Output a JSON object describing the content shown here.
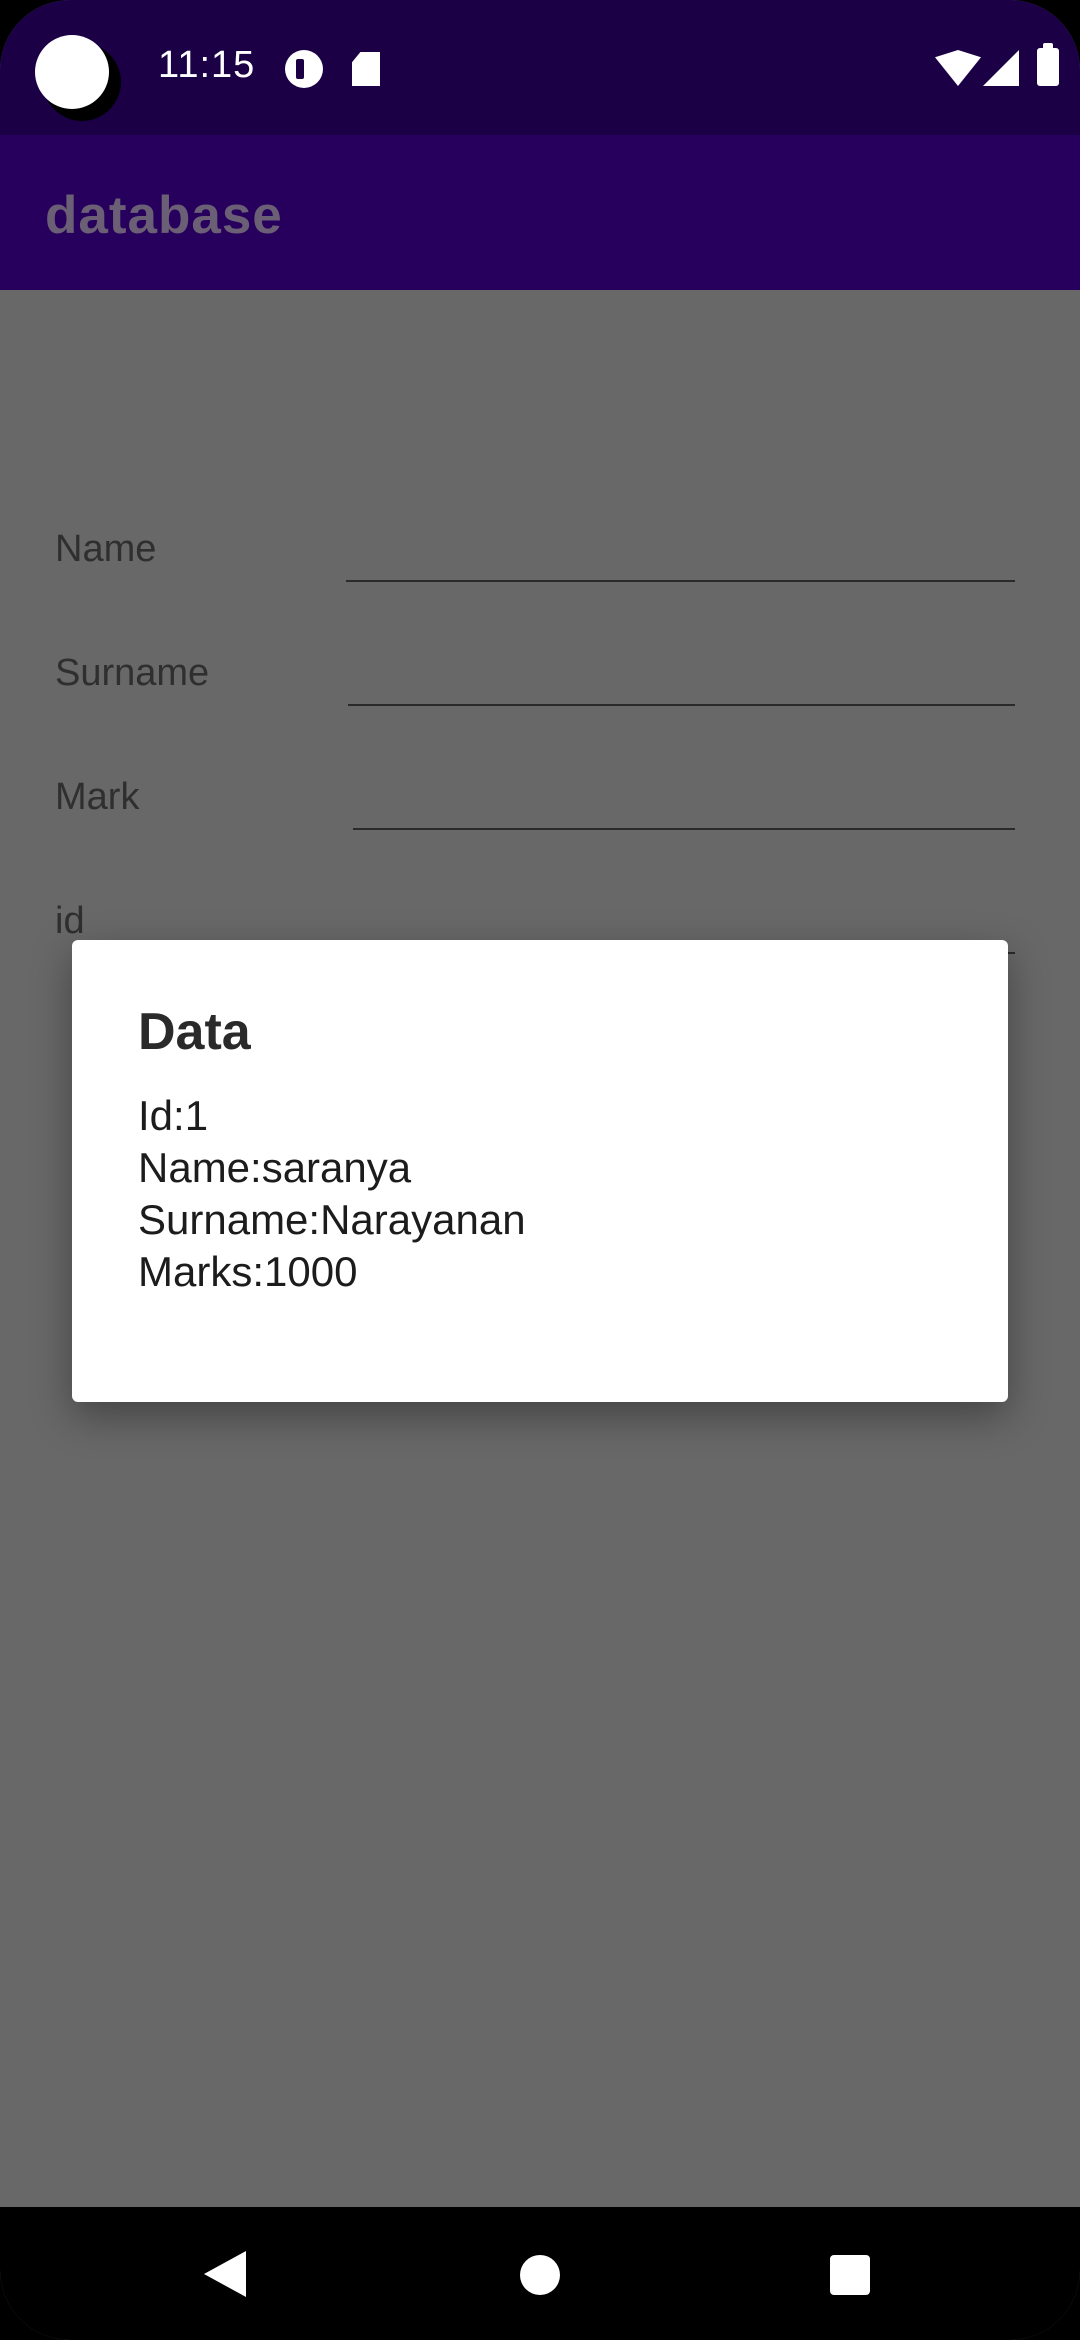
{
  "status_bar": {
    "time": "11:15",
    "icons": [
      "notification-app-icon",
      "sd-card-icon",
      "wifi-icon",
      "signal-icon",
      "battery-icon"
    ]
  },
  "app_bar": {
    "title": "database"
  },
  "form": {
    "fields": [
      {
        "label": "Name",
        "value": ""
      },
      {
        "label": "Surname",
        "value": ""
      },
      {
        "label": "Mark",
        "value": ""
      },
      {
        "label": "id",
        "value": ""
      }
    ]
  },
  "dialog": {
    "title": "Data",
    "lines": [
      "Id:1",
      "Name:saranya",
      "Surname:Narayanan",
      "Marks:1000"
    ]
  },
  "nav_bar": {
    "buttons": [
      "back-icon",
      "home-icon",
      "recents-icon"
    ]
  },
  "colors": {
    "status_bar": "#1b0046",
    "app_bar": "#27005e",
    "scrim": "#686868",
    "dialog_bg": "#ffffff"
  }
}
